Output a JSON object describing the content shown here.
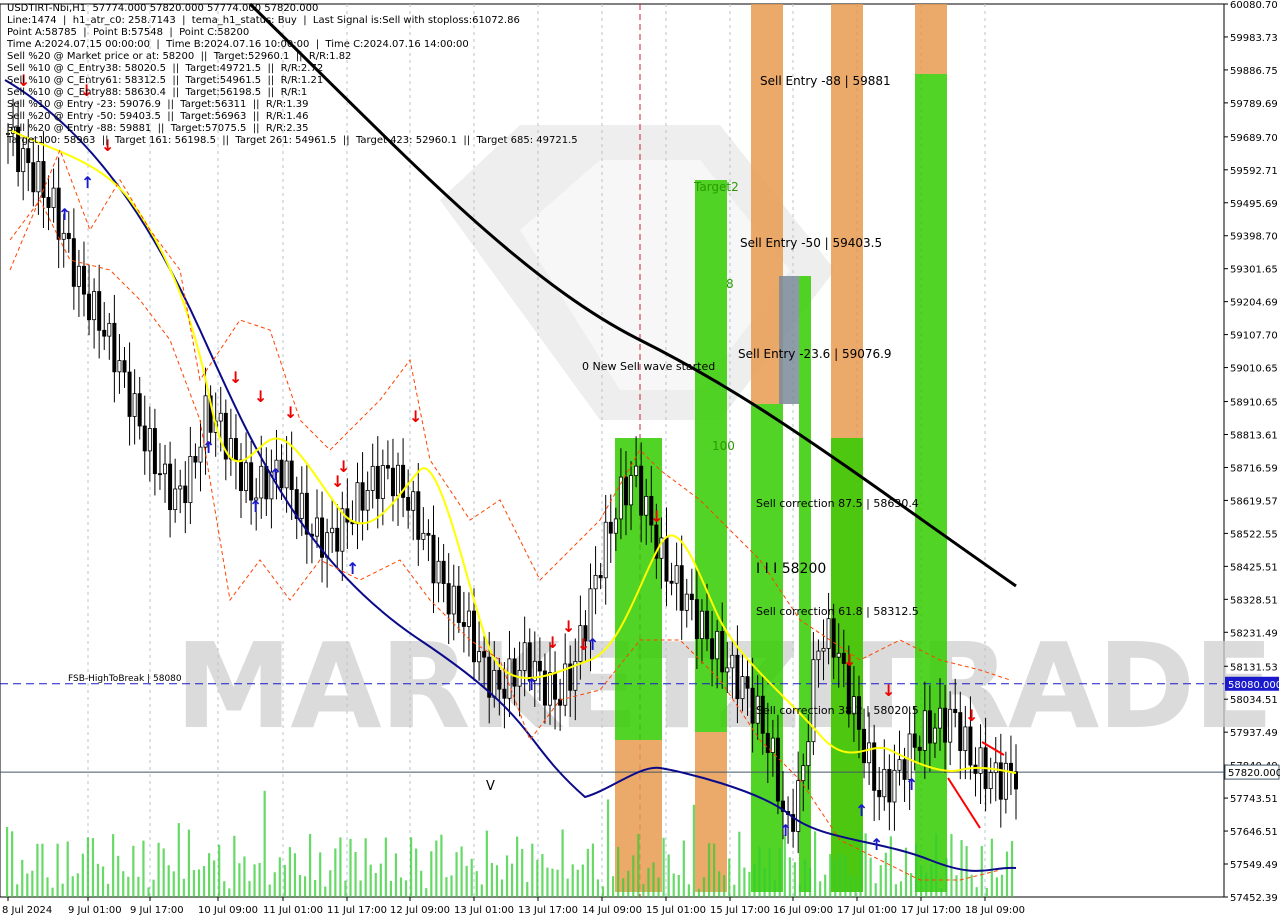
{
  "header": {
    "lines": [
      "USDTIRT-Nbi,H1  57774.000 57820.000 57774.000 57820.000",
      "Line:1474  |  h1_atr_c0: 258.7143  |  tema_h1_status: Buy  |  Last Signal is:Sell with stoploss:61072.86",
      "Point A:58785  |  Point B:57548  |  Point C:58200",
      "Time A:2024.07.15 00:00:00  |  Time B:2024.07.16 10:00:00  |  Time C:2024.07.16 14:00:00",
      "Sell %20 @ Market price or at: 58200  ||  Target:52960.1  ||  R/R:1.82",
      "Sell %10 @ C_Entry38: 58020.5  ||  Target:49721.5  ||  R/R:2.72",
      "Sell %10 @ C_Entry61: 58312.5  ||  Target:54961.5  ||  R/R:1.21",
      "Sell %10 @ C_Entry88: 58630.4  ||  Target:56198.5  ||  R/R:1",
      "Sell %10 @ Entry -23: 59076.9  ||  Target:56311  ||  R/R:1.39",
      "Sell %20 @ Entry -50: 59403.5  ||  Target:56963  ||  R/R:1.46",
      "Sell %20 @ Entry -88: 59881  ||  Target:57075.5  ||  R/R:2.35",
      "Target100: 58963  ||  Target 161: 56198.5  ||  Target 261: 54961.5  ||  Target 423: 52960.1  ||  Target 685: 49721.5"
    ]
  },
  "watermark": "MARKETZITRADE",
  "annotations": {
    "sell_entry_88": "Sell Entry -88 | 59881",
    "sell_entry_50": "Sell Entry -50 | 59403.5",
    "sell_entry_23": "Sell Entry -23.6 | 59076.9",
    "new_sell_wave": "0 New Sell wave started",
    "sell_corr_875": "Sell correction 87.5 | 58630.4",
    "point_c": "I I I 58200",
    "sell_corr_618": "Sell correction 61.8 | 58312.5",
    "sell_corr_382": "Sell correction 38.2 | 58020.5",
    "target2": "Target2",
    "t100": "100",
    "t_small": "8",
    "fsb_label": "FSB-HighToBreak | 58080",
    "v_mark": "V"
  },
  "colors": {
    "background": "#ffffff",
    "green_zone": "#33cc00",
    "orange_zone": "#e89a50",
    "gray_zone": "#7a8a9a",
    "price_blue_line": "#1a1acc",
    "ema_black": "#000000",
    "tema_yellow": "#ffff00",
    "ma_navy": "#0b0b8a",
    "channel_red": "#ff4400",
    "volume_green": "#33cc33"
  },
  "chart_data": {
    "type": "candlestick",
    "symbol": "USDTIRT-Nbi",
    "timeframe": "H1",
    "ylim": [
      57452.39,
      60080.7
    ],
    "y_ticks": [
      60080.7,
      59983.73,
      59886.75,
      59789.69,
      59689.7,
      59592.71,
      59495.69,
      59398.7,
      59301.65,
      59204.69,
      59107.7,
      59010.65,
      58910.65,
      58813.61,
      58716.59,
      58619.57,
      58522.55,
      58425.51,
      58328.51,
      58231.49,
      58131.53,
      58034.51,
      57937.49,
      57840.49,
      57743.51,
      57646.51,
      57549.49,
      57452.39
    ],
    "x_ticks": [
      "8 Jul 2024",
      "9 Jul 01:00",
      "9 Jul 17:00",
      "10 Jul 09:00",
      "11 Jul 01:00",
      "11 Jul 17:00",
      "12 Jul 09:00",
      "13 Jul 01:00",
      "13 Jul 17:00",
      "14 Jul 09:00",
      "15 Jul 01:00",
      "15 Jul 17:00",
      "16 Jul 09:00",
      "17 Jul 01:00",
      "17 Jul 17:00",
      "18 Jul 09:00"
    ],
    "horizontal_levels": [
      {
        "label": "58080.000",
        "value": 58080.0,
        "style": "dashed",
        "color": "#1a1acc"
      },
      {
        "label": "57820.000",
        "value": 57820.0,
        "style": "solid",
        "color": "#445566"
      }
    ],
    "close_path": [
      59700,
      59620,
      59560,
      59480,
      59350,
      59220,
      59150,
      59050,
      58920,
      58800,
      58700,
      58620,
      58700,
      58880,
      58830,
      58720,
      58640,
      58680,
      58720,
      58600,
      58520,
      58500,
      58550,
      58620,
      58680,
      58700,
      58640,
      58540,
      58420,
      58320,
      58260,
      58140,
      58060,
      58100,
      58160,
      58080,
      58040,
      58120,
      58300,
      58480,
      58620,
      58700,
      58560,
      58420,
      58360,
      58280,
      58200,
      58140,
      58080,
      58000,
      57880,
      57640,
      57800,
      58200,
      58220,
      58060,
      57900,
      57760,
      57800,
      57880,
      57940,
      57960,
      57980,
      57860,
      57820,
      57800,
      57820
    ]
  }
}
